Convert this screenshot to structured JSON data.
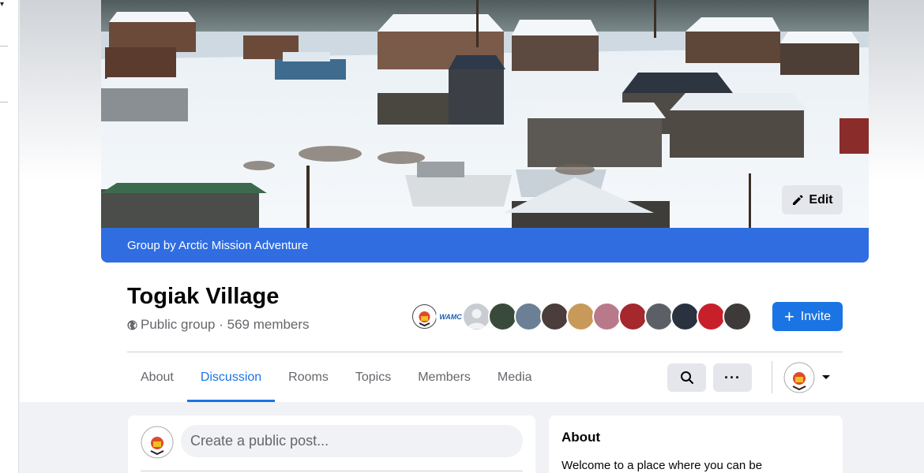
{
  "cover": {
    "edit_label": "Edit",
    "group_by": "Group by Arctic Mission Adventure"
  },
  "group": {
    "title": "Togiak Village",
    "meta": "Public group · 569 members",
    "globe_icon": "globe-icon",
    "invite_label": "Invite",
    "member_avatars": [
      "arctic-mission-logo",
      "wamc-logo",
      "default-avatar",
      "member-photo",
      "member-photo",
      "member-photo",
      "member-photo",
      "member-photo",
      "member-photo",
      "member-photo",
      "member-photo",
      "member-photo",
      "member-photo"
    ]
  },
  "tabs": [
    {
      "label": "About"
    },
    {
      "label": "Discussion",
      "active": true
    },
    {
      "label": "Rooms"
    },
    {
      "label": "Topics"
    },
    {
      "label": "Members"
    },
    {
      "label": "Media"
    }
  ],
  "actions": {
    "search_icon": "search-icon",
    "more_icon": "more-icon",
    "dropdown_icon": "caret-down-icon"
  },
  "composer": {
    "placeholder": "Create a public post..."
  },
  "about": {
    "heading": "About",
    "description": "Welcome to a place where you can be"
  },
  "colors": {
    "accent": "#1b74e4",
    "group_bar": "#2f6de1",
    "page_bg": "#f0f2f5"
  }
}
